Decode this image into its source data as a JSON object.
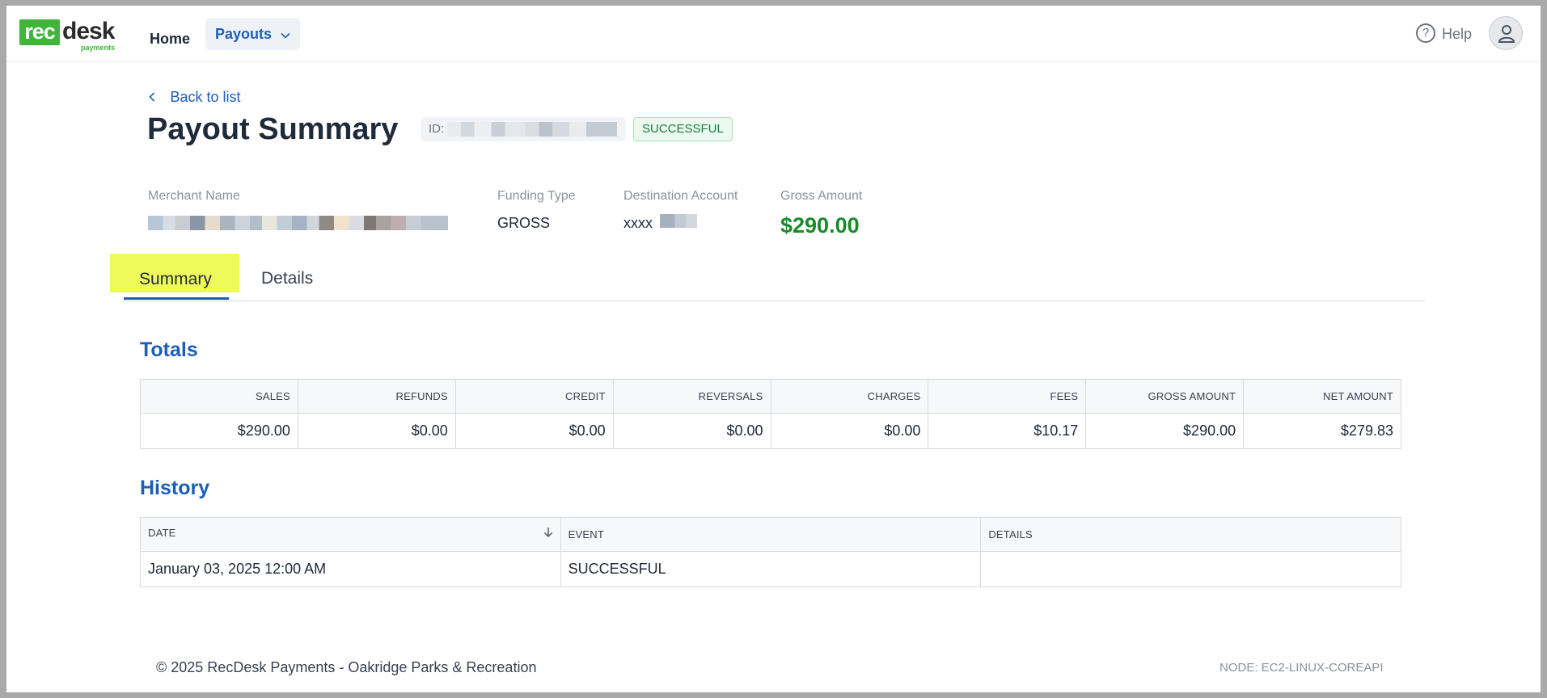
{
  "header": {
    "logo_main": "rec",
    "logo_second": "desk",
    "logo_sub": "payments",
    "nav": {
      "home": "Home",
      "payouts": "Payouts"
    },
    "help": "Help"
  },
  "page": {
    "back_link": "Back to list",
    "title": "Payout Summary",
    "id_label": "ID:",
    "status": "SUCCESSFUL"
  },
  "info": {
    "merchant_label": "Merchant Name",
    "funding_label": "Funding Type",
    "funding_value": "GROSS",
    "destination_label": "Destination Account",
    "destination_value": "xxxx",
    "gross_label": "Gross Amount",
    "gross_value": "$290.00"
  },
  "tabs": {
    "summary": "Summary",
    "details": "Details"
  },
  "totals": {
    "title": "Totals",
    "headers": [
      "SALES",
      "REFUNDS",
      "CREDIT",
      "REVERSALS",
      "CHARGES",
      "FEES",
      "GROSS AMOUNT",
      "NET AMOUNT"
    ],
    "values": [
      "$290.00",
      "$0.00",
      "$0.00",
      "$0.00",
      "$0.00",
      "$10.17",
      "$290.00",
      "$279.83"
    ]
  },
  "history": {
    "title": "History",
    "headers": [
      "DATE",
      "EVENT",
      "DETAILS"
    ],
    "rows": [
      {
        "date": "January 03, 2025 12:00 AM",
        "event": "SUCCESSFUL",
        "details": ""
      }
    ]
  },
  "footer": {
    "copyright": "© 2025 RecDesk Payments - Oakridge Parks & Recreation",
    "node": "NODE: EC2-LINUX-COREAPI"
  },
  "colors": {
    "accent": "#1d5fb8",
    "brand_green": "#3fb63a",
    "gross_green": "#198a2a",
    "tab_highlight": "#eef95a"
  },
  "icons": {
    "back": "chevron-left-icon",
    "dropdown": "chevron-down-icon",
    "help": "question-circle-icon",
    "avatar": "user-icon",
    "sort": "arrow-down-icon"
  }
}
